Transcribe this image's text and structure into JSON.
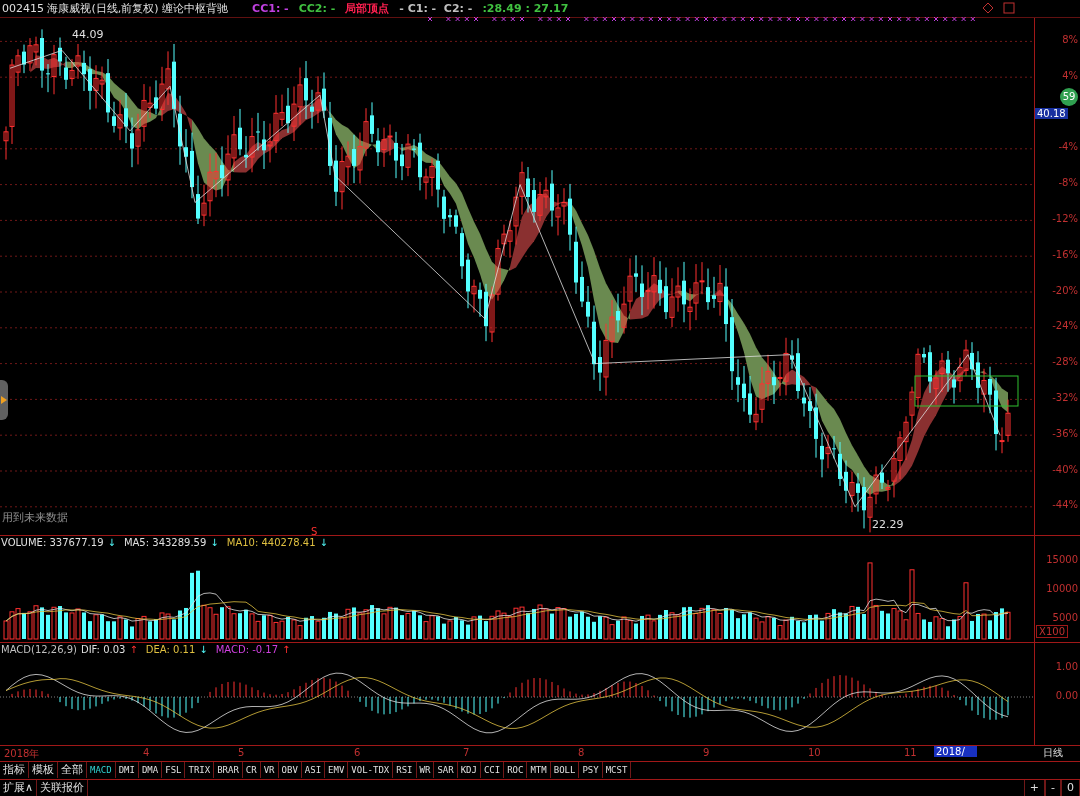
{
  "header": {
    "title": "002415 海康威视(日线,前复权) 缠论中枢背驰",
    "indicators": [
      {
        "label": "CC1: -",
        "color": "#c040e0"
      },
      {
        "label": "CC2: -",
        "color": "#40c040"
      },
      {
        "label": "局部顶点",
        "color": "#ff2050"
      },
      {
        "label": "- C1: -  C2: -",
        "color": "#c0c0c0"
      },
      {
        "label": ":28.49 : 27.17",
        "color": "#40c040"
      }
    ]
  },
  "price_chart": {
    "peak_label": "44.09",
    "trough_label": "22.29",
    "notice": "用到未来数据",
    "signal": "S",
    "axis_ticks": [
      "8%",
      "4%",
      "-4%",
      "-8%",
      "-12%",
      "-16%",
      "-20%",
      "-24%",
      "-28%",
      "-32%",
      "-36%",
      "-40%",
      "-44%"
    ],
    "current_price": "40.18",
    "badge": "59"
  },
  "volume": {
    "labels": [
      {
        "text": "VOLUME: 337677.19",
        "color": "#e0e0e0",
        "trend": "↓"
      },
      {
        "text": "MA5: 343289.59",
        "color": "#e0e0e0",
        "trend": "↓"
      },
      {
        "text": "MA10: 440278.41",
        "color": "#e0c040",
        "trend": "↓"
      }
    ],
    "axis_ticks": [
      "15000",
      "10000",
      "5000"
    ],
    "unit": "X100"
  },
  "macd": {
    "labels": [
      {
        "text": "MACD(12,26,9)",
        "color": "#c0c0c0"
      },
      {
        "text": "DIF: 0.03",
        "color": "#e0e0e0",
        "trend": "↑"
      },
      {
        "text": "DEA: 0.11",
        "color": "#e0c040",
        "trend": "↓"
      },
      {
        "text": "MACD: -0.17",
        "color": "#d040e0",
        "trend": "↑"
      }
    ],
    "axis_ticks": [
      "1.00",
      "0.00"
    ]
  },
  "date_axis": {
    "labels": [
      "2018年",
      "4",
      "5",
      "6",
      "7",
      "8",
      "9",
      "10",
      "11"
    ],
    "cursor_date": "2018/",
    "period": "日线"
  },
  "toolbar": {
    "groups": [
      {
        "label": "指标",
        "selected": false
      },
      {
        "label": "模板",
        "selected": false
      },
      {
        "label": "全部",
        "selected": false
      }
    ],
    "tabs": [
      {
        "label": "MACD",
        "selected": true
      },
      {
        "label": "DMI",
        "selected": false
      },
      {
        "label": "DMA",
        "selected": false
      },
      {
        "label": "FSL",
        "selected": false
      },
      {
        "label": "TRIX",
        "selected": false
      },
      {
        "label": "BRAR",
        "selected": false
      },
      {
        "label": "CR",
        "selected": false
      },
      {
        "label": "VR",
        "selected": false
      },
      {
        "label": "OBV",
        "selected": false
      },
      {
        "label": "ASI",
        "selected": false
      },
      {
        "label": "EMV",
        "selected": false
      },
      {
        "label": "VOL-TDX",
        "selected": false
      },
      {
        "label": "RSI",
        "selected": false
      },
      {
        "label": "WR",
        "selected": false
      },
      {
        "label": "SAR",
        "selected": false
      },
      {
        "label": "KDJ",
        "selected": false
      },
      {
        "label": "CCI",
        "selected": false
      },
      {
        "label": "ROC",
        "selected": false
      },
      {
        "label": "MTM",
        "selected": false
      },
      {
        "label": "BOLL",
        "selected": false
      },
      {
        "label": "PSY",
        "selected": false
      },
      {
        "label": "MCST",
        "selected": false
      }
    ]
  },
  "bottom_bar": {
    "buttons": [
      "扩展∧",
      "关联报价"
    ],
    "zoom_controls": [
      "+",
      "-",
      "0"
    ]
  }
}
